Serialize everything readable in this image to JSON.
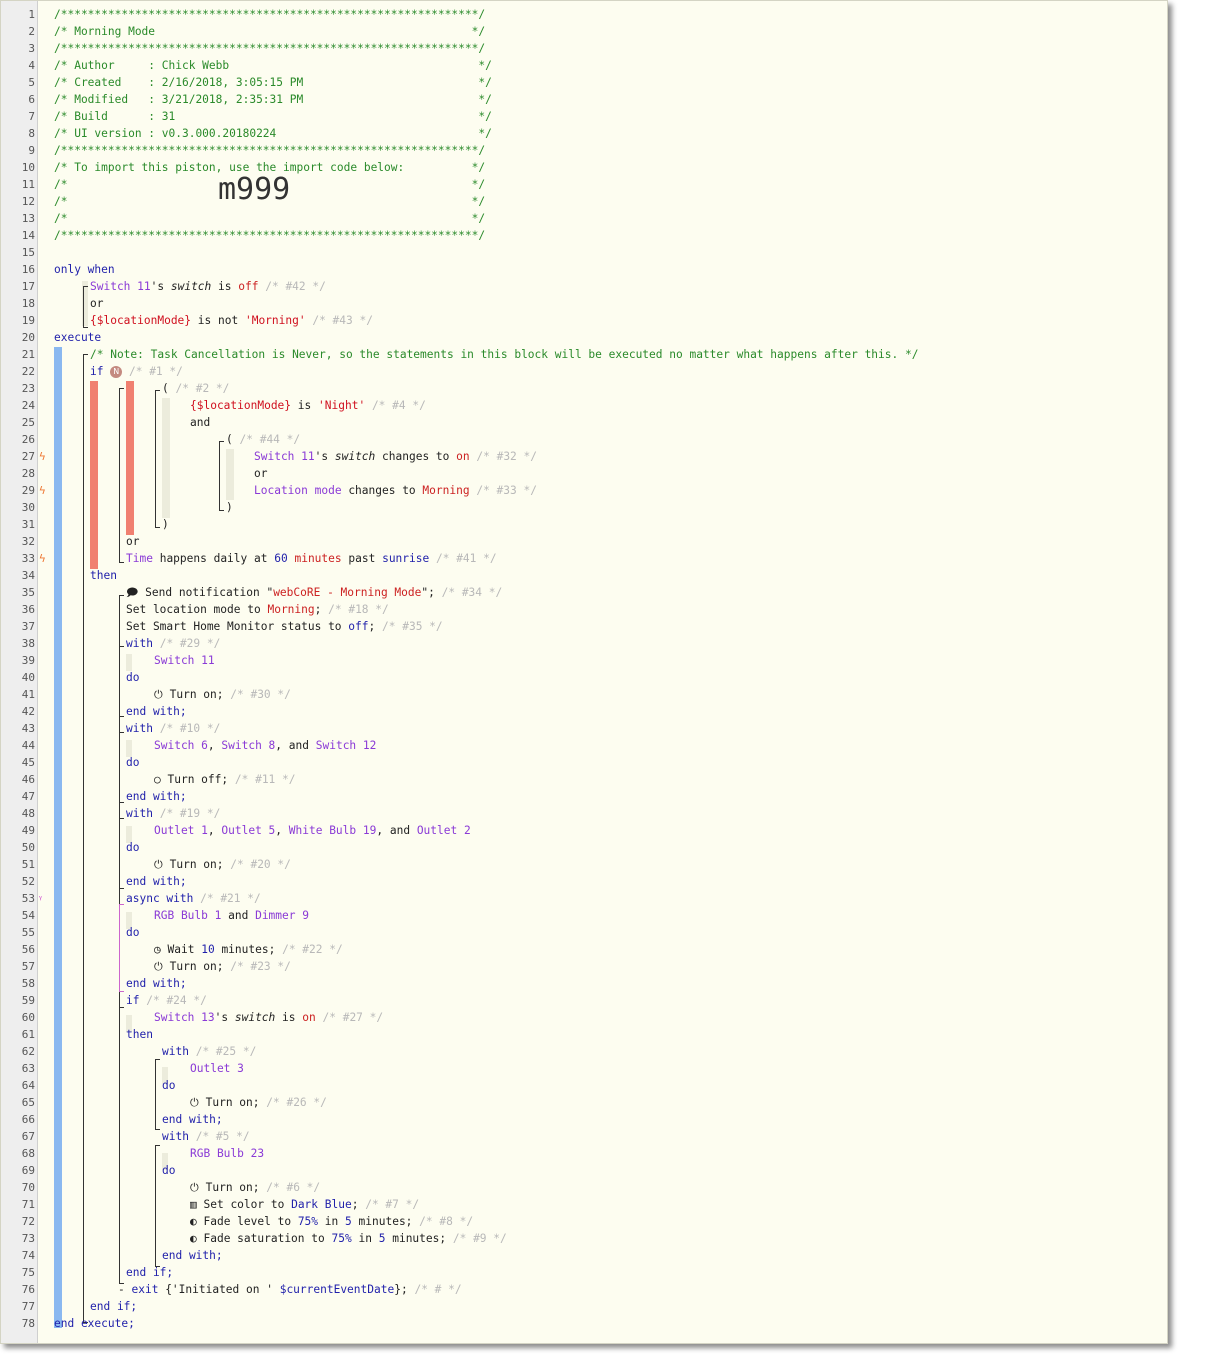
{
  "piston": {
    "hr": "/**************************************************************/",
    "lines": {
      "2": "/* Morning Mode                                               */",
      "4": "/* Author     : Chick Webb                                     */",
      "5": "/* Created    : 2/16/2018, 3:05:15 PM                          */",
      "6": "/* Modified   : 3/21/2018, 2:35:31 PM                          */",
      "7": "/* Build      : 31                                             */",
      "8": "/* UI version : v0.3.000.20180224                              */",
      "10": "/* To import this piston, use the import code below:          */",
      "11": "/*                                                            */",
      "12": "/*                                                            */",
      "13": "/*                                                            */"
    },
    "import_code": "m999"
  },
  "labels": {
    "only_when": "only when",
    "execute": "execute",
    "end_execute": "end execute;",
    "or": "or",
    "and": "and",
    "if": "if",
    "then": "then",
    "end_if": "end if;",
    "with": "with",
    "async_with": "async with",
    "do": "do",
    "end_with": "end with;",
    "open_paren": "(",
    "close_paren": ")",
    "n_badge": "N"
  },
  "code": {
    "note": "/* Note: Task Cancellation is Never, so the statements in this block will be executed no matter what happens after this. */",
    "sw11": "Switch 11",
    "sw13": "Switch 13",
    "switch_attr": "switch",
    "off": "off",
    "on": "on",
    "location_mode_var": "{$locationMode}",
    "location_mode": "Location mode",
    "morning_str": "'Morning'",
    "night_str": "'Night'",
    "morning": "Morning",
    "changes_to": "changes to",
    "is": "is",
    "is_not": "is not",
    "poss_switch": "'s",
    "time_text": "Time",
    "time_happens": "happens daily at",
    "sixty": "60",
    "minutes": "minutes",
    "past": "past",
    "sunrise": "sunrise",
    "send_notification": "Send notification",
    "quote_open": "\"",
    "notif_msg": "webCoRE - Morning Mode",
    "quote_close_semicolon": "\";",
    "set_location_mode_to": "Set location mode to",
    "shm_status": "Set Smart Home Monitor status to",
    "semicolon": ";",
    "comma": ",",
    "and_word": "and",
    "sw6": "Switch 6",
    "sw8": "Switch 8",
    "sw12": "Switch 12",
    "outlet1": "Outlet 1",
    "outlet5": "Outlet 5",
    "wb19": "White Bulb 19",
    "outlet2": "Outlet 2",
    "rgb1": "RGB Bulb 1",
    "dimmer9": "Dimmer 9",
    "outlet3": "Outlet 3",
    "rgb23": "RGB Bulb 23",
    "turn_on": "Turn on;",
    "turn_off": "Turn off;",
    "wait": "Wait",
    "ten": "10",
    "minutes_semi": "minutes;",
    "set_color_to": "Set color to",
    "dark_blue": "Dark Blue",
    "fade_level_to": "Fade level to",
    "fade_sat_to": "Fade saturation to",
    "seventy_five": "75",
    "pct": "%",
    "in": "in",
    "five": "5",
    "exit": "exit",
    "exit_open": "{'Initiated on ' ",
    "current_event_date": "$currentEventDate",
    "exit_close": "};",
    "c42": "/* #42 */",
    "c43": "/* #43 */",
    "c1": "/* #1 */",
    "c2": "/* #2 */",
    "c4": "/* #4 */",
    "c44": "/* #44 */",
    "c32": "/* #32 */",
    "c33": "/* #33 */",
    "c41": "/* #41 */",
    "c34": "/* #34 */",
    "c18": "/* #18 */",
    "c35": "/* #35 */",
    "c29": "/* #29 */",
    "c30": "/* #30 */",
    "c10": "/* #10 */",
    "c11": "/* #11 */",
    "c19": "/* #19 */",
    "c20": "/* #20 */",
    "c21": "/* #21 */",
    "c22": "/* #22 */",
    "c23": "/* #23 */",
    "c24": "/* #24 */",
    "c27": "/* #27 */",
    "c25": "/* #25 */",
    "c26": "/* #26 */",
    "c5": "/* #5 */",
    "c6": "/* #6 */",
    "c7": "/* #7 */",
    "c8": "/* #8 */",
    "c9": "/* #9 */",
    "chash": "/* # */"
  },
  "colors": {
    "comment": "#2a8a2a",
    "keyword": "#1f1faa",
    "device": "#8a3ad6",
    "string": "#d0101f",
    "dim_comment": "#b8b8b8",
    "execute_bar": "#8ab8f0",
    "condition_bar": "#f08070"
  },
  "gutter_markers": {
    "trigger": "lightning-bolt-icon",
    "async": "async-fork-icon"
  }
}
